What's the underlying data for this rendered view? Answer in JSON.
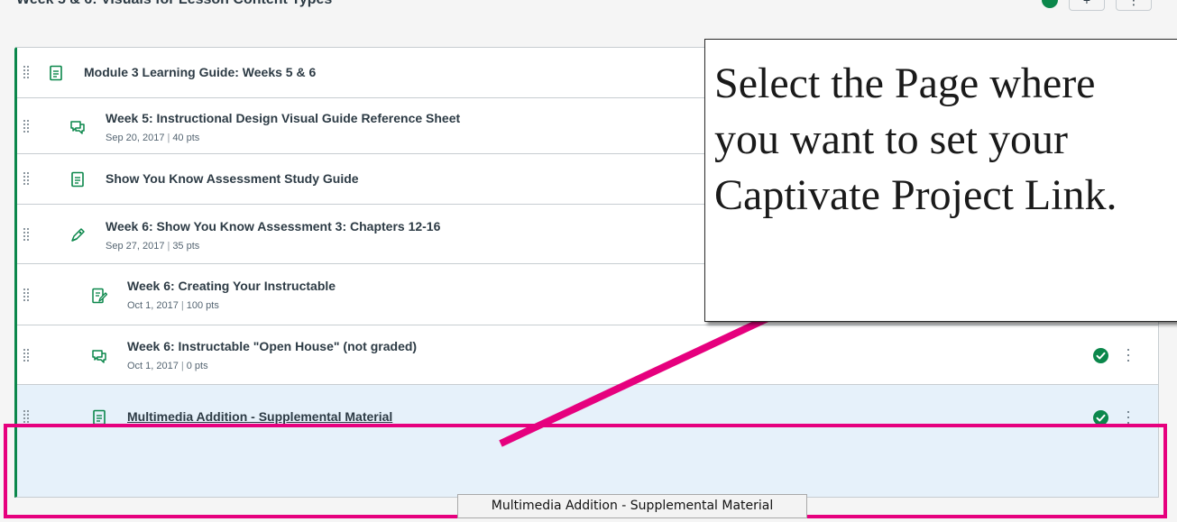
{
  "module_header": {
    "title": "Week 5 & 6: Visuals for Lesson Content Types",
    "add_button_label": "+",
    "menu_button_label": "⋮"
  },
  "items": [
    {
      "title": "Module 3 Learning Guide: Weeks 5 & 6",
      "meta": null,
      "icon": "page-icon",
      "indent": 0,
      "published": true
    },
    {
      "title": "Week 5: Instructional Design Visual Guide Reference Sheet",
      "meta": {
        "date": "Sep 20, 2017",
        "points": "40 pts"
      },
      "icon": "discussion-icon",
      "indent": 1,
      "published": true
    },
    {
      "title": "Show You Know Assessment Study Guide",
      "meta": null,
      "icon": "page-icon",
      "indent": 1,
      "published": true
    },
    {
      "title": "Week 6: Show You Know Assessment 3: Chapters 12-16",
      "meta": {
        "date": "Sep 27, 2017",
        "points": "35 pts"
      },
      "icon": "quiz-icon",
      "indent": 1,
      "published": true
    },
    {
      "title": "Week 6: Creating Your Instructable",
      "meta": {
        "date": "Oct 1, 2017",
        "points": "100 pts"
      },
      "icon": "assignment-icon",
      "indent": 2,
      "published": true
    },
    {
      "title": "Week 6: Instructable \"Open House\" (not graded)",
      "meta": {
        "date": "Oct 1, 2017",
        "points": "0 pts"
      },
      "icon": "discussion-icon",
      "indent": 2,
      "published": true
    },
    {
      "title": "Multimedia Addition - Supplemental Material",
      "meta": null,
      "icon": "page-icon",
      "indent": 2,
      "published": true,
      "selected": true
    }
  ],
  "meta_separator": "|",
  "callout": {
    "lines": [
      "Select the Page where",
      "you want to set your",
      "Captivate Project Link."
    ]
  },
  "tooltip": {
    "text": "Multimedia Addition - Supplemental Material"
  },
  "colors": {
    "published": "#0b874b",
    "highlight": "#e6007e",
    "selected_row": "#e6f1fa",
    "border": "#c7cdd1"
  }
}
